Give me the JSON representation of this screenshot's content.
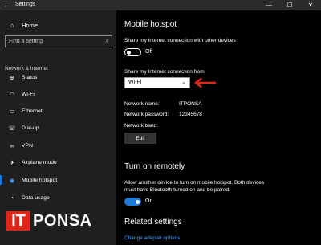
{
  "window": {
    "title": "Settings",
    "back_glyph": "←",
    "min_glyph": "—",
    "max_glyph": "☐",
    "close_glyph": "✕"
  },
  "sidebar": {
    "home": {
      "label": "Home",
      "icon": "home-icon",
      "glyph": "⌂"
    },
    "search": {
      "placeholder": "Find a setting",
      "icon_glyph": "⌕"
    },
    "section": "Network & Internet",
    "items": [
      {
        "label": "Status",
        "icon": "status-icon",
        "glyph": "⊕",
        "active": false
      },
      {
        "label": "Wi-Fi",
        "icon": "wifi-icon",
        "glyph": "◠",
        "active": false
      },
      {
        "label": "Ethernet",
        "icon": "ethernet-icon",
        "glyph": "▭",
        "active": false
      },
      {
        "label": "Dial-up",
        "icon": "dialup-icon",
        "glyph": "☏",
        "active": false
      },
      {
        "label": "VPN",
        "icon": "vpn-icon",
        "glyph": "∞",
        "active": false
      },
      {
        "label": "Airplane mode",
        "icon": "airplane-icon",
        "glyph": "✈",
        "active": false
      },
      {
        "label": "Mobile hotspot",
        "icon": "hotspot-icon",
        "glyph": "◉",
        "active": true
      },
      {
        "label": "Data usage",
        "icon": "data-usage-icon",
        "glyph": "◔",
        "active": false
      }
    ],
    "accent_color": "#1e7ad9"
  },
  "main": {
    "title": "Mobile hotspot",
    "share_desc": "Share my Internet connection with other devices",
    "share_toggle": {
      "state": "Off"
    },
    "from_label": "Share my Internet connection from",
    "from_select": {
      "value": "Wi-Fi",
      "chevron": "⌄"
    },
    "network_name_label": "Network name:",
    "network_name_value": "ITPONSA",
    "network_password_label": "Network password:",
    "network_password_value": "12345678",
    "network_band_label": "Network band:",
    "edit_button": "Edit",
    "remote_title": "Turn on remotely",
    "remote_desc_1": "Allow another device to turn on mobile hotspot. Both devices",
    "remote_desc_2": "must have Bluetooth turned on and be paired.",
    "remote_toggle": {
      "state": "On"
    },
    "related_title": "Related settings",
    "related_link": "Change adapter options"
  },
  "watermark": {
    "part1": "IT",
    "part2": "PONSA",
    "color": "#e0261b"
  }
}
